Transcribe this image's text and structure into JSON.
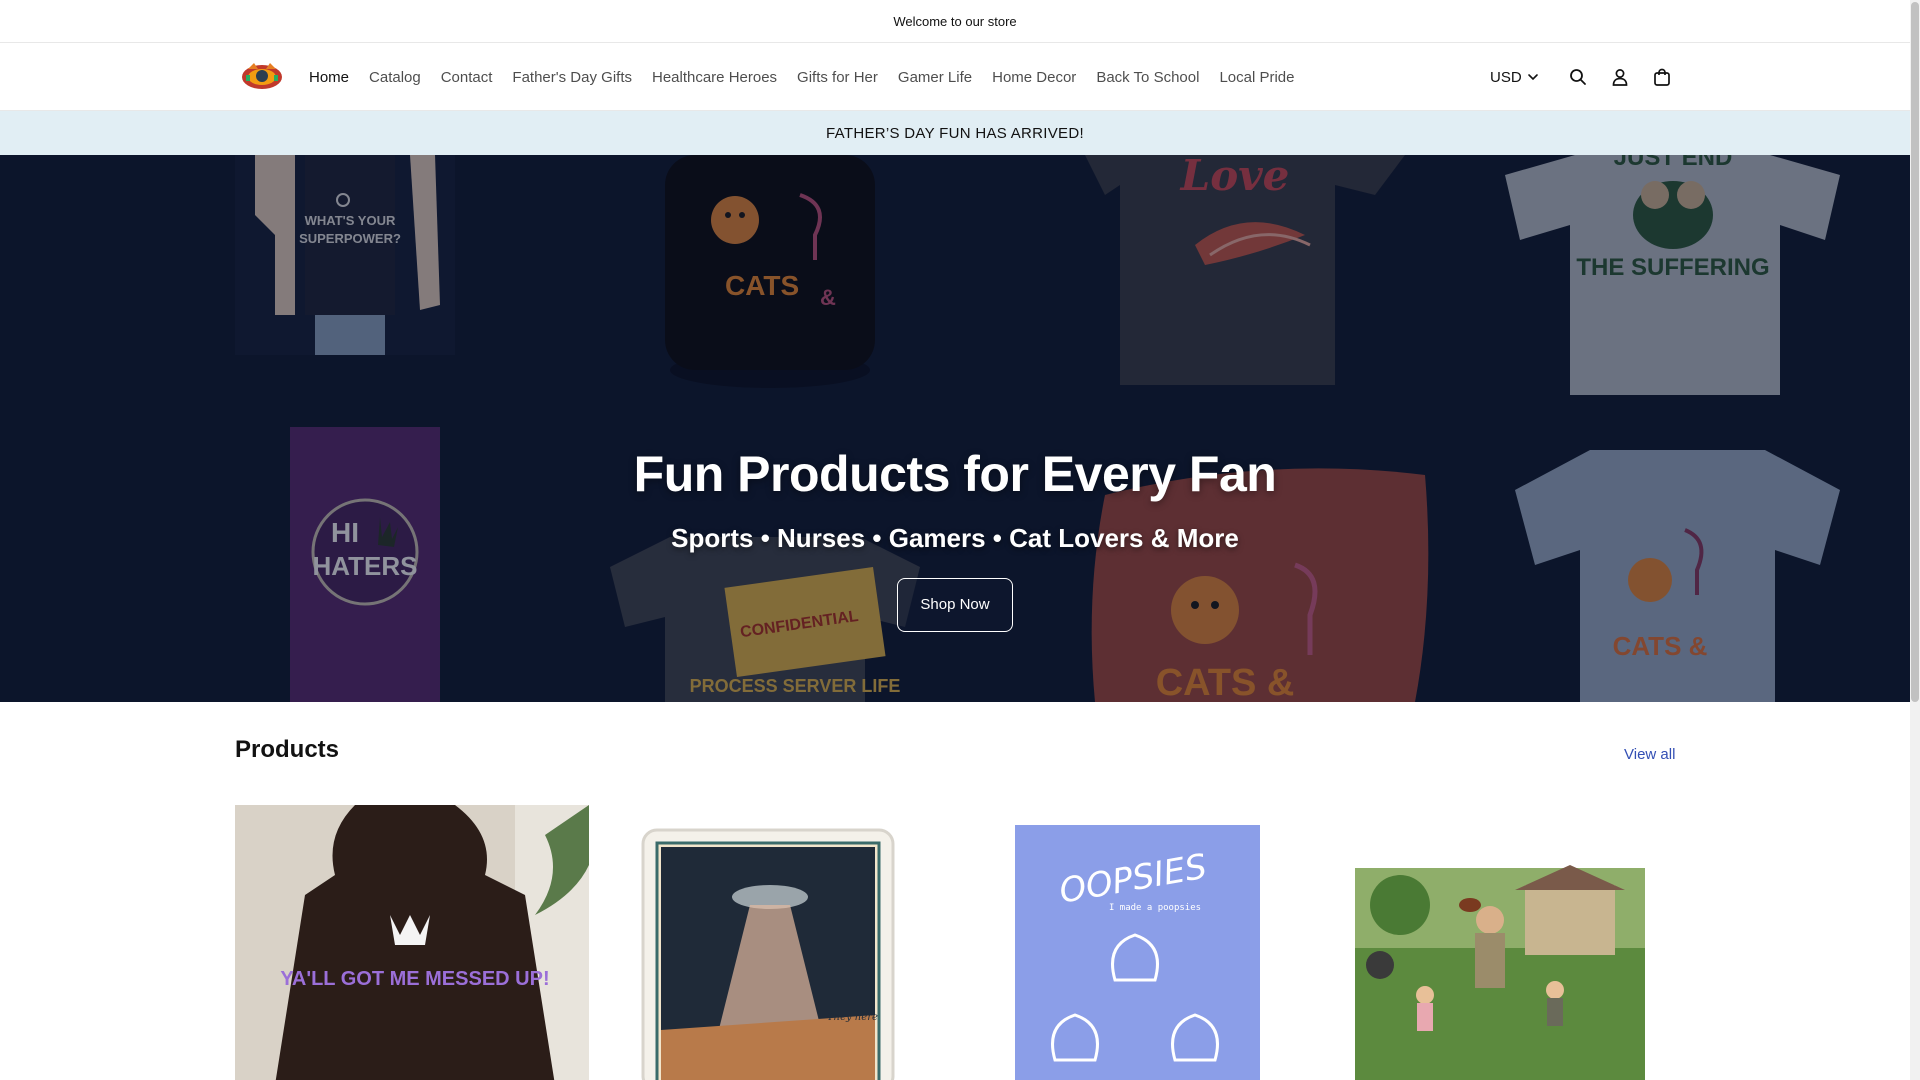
{
  "announcement": {
    "text": "Welcome to our store"
  },
  "header": {
    "logo_alt": "Store logo",
    "nav": [
      {
        "label": "Home",
        "active": true
      },
      {
        "label": "Catalog"
      },
      {
        "label": "Contact"
      },
      {
        "label": "Father's Day Gifts"
      },
      {
        "label": "Healthcare Heroes"
      },
      {
        "label": "Gifts for Her"
      },
      {
        "label": "Gamer Life"
      },
      {
        "label": "Home Decor"
      },
      {
        "label": "Back To School"
      },
      {
        "label": "Local Pride"
      }
    ],
    "currency": "USD",
    "icons": [
      "search-icon",
      "account-icon",
      "cart-icon"
    ]
  },
  "promo": {
    "text": "FATHER’S DAY FUN HAS ARRIVED!"
  },
  "hero": {
    "title": "Fun Products for Every Fan",
    "subtitle": "Sports • Nurses • Gamers • Cat Lovers & More",
    "button": "Shop Now",
    "tiles": {
      "nurse_shirt": "WHAT'S YOUR SUPERPOWER?",
      "mug": "CATS & WINE",
      "love_shirt": "Love",
      "suffering_shirt_top": "JUST END",
      "suffering_shirt": "THE SUFFERING",
      "haters_banner_1": "HI",
      "haters_banner_2": "HATERS",
      "process_shirt": "PROCESS SERVER LIFE",
      "envelope": "CONFIDENTIAL",
      "pillow": "CATS &",
      "blue_shirt": "CATS & WINE"
    }
  },
  "products": {
    "title": "Products",
    "view_all": "View all",
    "items": [
      {
        "image_text": "YA'LL GOT ME MESSED UP!"
      },
      {
        "image_text": "They here"
      },
      {
        "image_text": "OOPSIES",
        "image_subtext": "I made a poopsies"
      },
      {
        "image_text": ""
      }
    ]
  },
  "colors": {
    "link": "#334fb4",
    "promo_bg": "#e1eef4",
    "hero_bg": "#101a30"
  }
}
